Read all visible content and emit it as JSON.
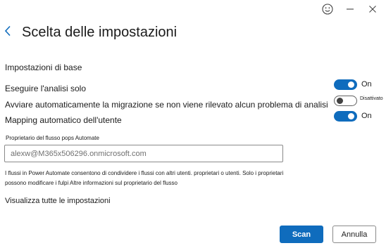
{
  "window_controls": {
    "feedback_icon": "smiley-icon",
    "minimize_icon": "minimize-icon",
    "close_icon": "close-icon"
  },
  "header": {
    "back_icon": "chevron-left-icon",
    "title": "Scelta delle impostazioni"
  },
  "basic_settings": {
    "section_label": "Impostazioni di base",
    "rows": [
      {
        "label": "Eseguire l'analisi solo",
        "state": "on",
        "state_text": "On"
      },
      {
        "label": "Avviare automaticamente la migrazione se non viene rilevato alcun problema di analisi",
        "state": "off",
        "state_text": "Disattivato"
      },
      {
        "label": "Mapping automatico dell'utente",
        "state": "on",
        "state_text": "On"
      }
    ]
  },
  "owner_field": {
    "label": "Proprietario del flusso pops Automate",
    "value": "alexw@M365x506296.onmicrosoft.com"
  },
  "info_text": "I flussi in Power Automate consentono di condividere i flussi con altri utenti. proprietari o utenti. Solo i proprietari possono modificare i fulpi Altre informazioni sul proprietario del flusso",
  "view_all_link": "Visualizza tutte le impostazioni",
  "footer": {
    "primary_button": "Scan",
    "secondary_button": "Annulla"
  },
  "colors": {
    "accent": "#0f6cbd",
    "text": "#1b1b1b"
  }
}
